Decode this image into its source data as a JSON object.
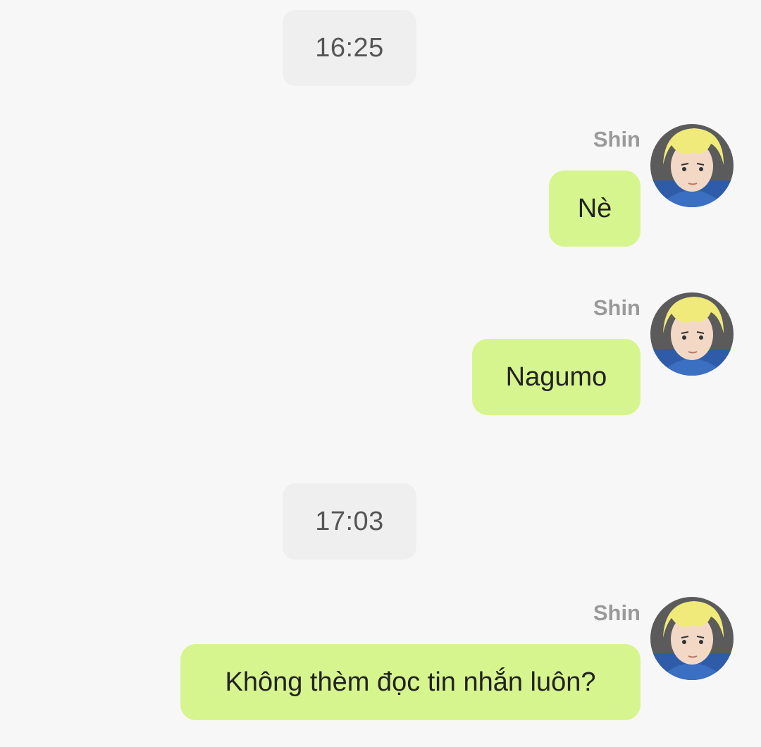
{
  "chat": {
    "messages": [
      {
        "type": "timestamp",
        "text": "16:25"
      },
      {
        "type": "message",
        "sender": "Shin",
        "text": "Nè"
      },
      {
        "type": "message",
        "sender": "Shin",
        "text": "Nagumo"
      },
      {
        "type": "timestamp",
        "text": "17:03"
      },
      {
        "type": "message",
        "sender": "Shin",
        "text": "Không thèm đọc tin nhắn luôn?"
      }
    ]
  },
  "theme": {
    "background": "#f7f7f7",
    "bubble_color": "#d7f58e",
    "timestamp_chip_color": "#efefef",
    "sender_name_color": "#9a9a9a"
  },
  "icons": {
    "avatar": "avatar-icon"
  }
}
